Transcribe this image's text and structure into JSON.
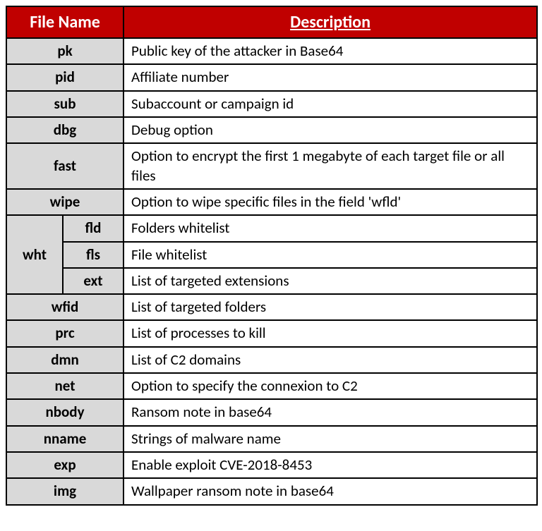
{
  "header": {
    "filename": "File Name",
    "description": "Description"
  },
  "rows": {
    "pk": {
      "name": "pk",
      "desc": "Public key of the attacker in Base64"
    },
    "pid": {
      "name": "pid",
      "desc": "Affiliate number"
    },
    "sub": {
      "name": "sub",
      "desc": "Subaccount or campaign id"
    },
    "dbg": {
      "name": "dbg",
      "desc": "Debug option"
    },
    "fast": {
      "name": "fast",
      "desc": "Option to encrypt the first 1 megabyte of each target file or all files"
    },
    "wipe": {
      "name": "wipe",
      "desc": "Option to wipe specific files in the field 'wfld'"
    },
    "wht": {
      "name": "wht"
    },
    "fld": {
      "name": "fld",
      "desc": "Folders whitelist"
    },
    "fls": {
      "name": "fls",
      "desc": "File whitelist"
    },
    "ext": {
      "name": "ext",
      "desc": "List of targeted extensions"
    },
    "wfid": {
      "name": "wfid",
      "desc": "List of targeted folders"
    },
    "prc": {
      "name": "prc",
      "desc": "List of processes to kill"
    },
    "dmn": {
      "name": "dmn",
      "desc": "List of C2 domains"
    },
    "net": {
      "name": "net",
      "desc": "Option to specify the connexion to C2"
    },
    "nbody": {
      "name": "nbody",
      "desc": "Ransom note in base64"
    },
    "nname": {
      "name": "nname",
      "desc": "Strings of malware name"
    },
    "exp": {
      "name": "exp",
      "desc": "Enable exploit CVE-2018-8453"
    },
    "img": {
      "name": "img",
      "desc": "Wallpaper ransom note in base64"
    }
  }
}
